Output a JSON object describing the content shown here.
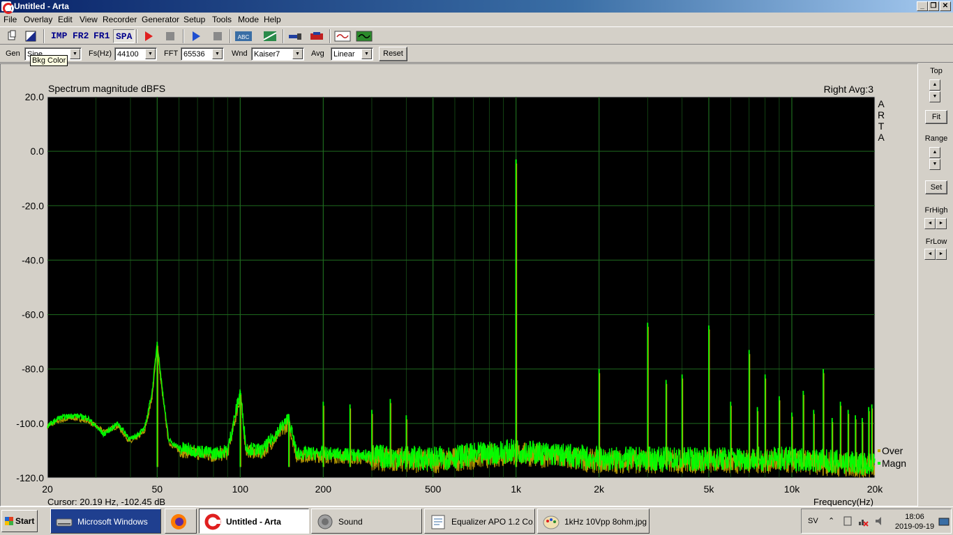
{
  "window": {
    "title": "Untitled - Arta",
    "min": "_",
    "restore": "❐",
    "close": "✕"
  },
  "menu": [
    "File",
    "Overlay",
    "Edit",
    "View",
    "Recorder",
    "Generator",
    "Setup",
    "Tools",
    "Mode",
    "Help"
  ],
  "toolbar": {
    "imp": "IMP",
    "fr2": "FR2",
    "fr1": "FR1",
    "spa": "SPA",
    "abc": "ABC"
  },
  "controls": {
    "gen_label": "Gen",
    "gen_value": "Sine",
    "fs_label": "Fs(Hz)",
    "fs_value": "44100",
    "fft_label": "FFT",
    "fft_value": "65536",
    "wnd_label": "Wnd",
    "wnd_value": "Kaiser7",
    "avg_label": "Avg",
    "avg_value": "Linear",
    "reset": "Reset",
    "tooltip": "Bkg Color"
  },
  "right_panel": {
    "top": "Top",
    "fit": "Fit",
    "range": "Range",
    "set": "Set",
    "frhigh": "FrHigh",
    "frlow": "FrLow"
  },
  "chart_data": {
    "type": "line",
    "title": "Spectrum magnitude dBFS",
    "channel_info": "Right  Avg:3",
    "watermark": "ARTA",
    "xlabel": "Frequency(Hz)",
    "ylabel": "",
    "x_scale": "log",
    "xlim": [
      20,
      20000
    ],
    "ylim": [
      -120,
      20
    ],
    "x_ticks": [
      20,
      50,
      100,
      200,
      500,
      1000,
      2000,
      5000,
      10000,
      20000
    ],
    "x_tick_labels": [
      "20",
      "50",
      "100",
      "200",
      "500",
      "1k",
      "2k",
      "5k",
      "10k",
      "20k"
    ],
    "y_ticks": [
      20,
      0,
      -20,
      -40,
      -60,
      -80,
      -100,
      -120
    ],
    "y_tick_labels": [
      "20.0",
      "0.0",
      "-20.0",
      "-40.0",
      "-60.0",
      "-80.0",
      "-100.0",
      "-120.0"
    ],
    "cursor": "Cursor: 20.19 Hz, -102.45 dB",
    "grid": true,
    "background": "#000000",
    "grid_color": "#1f6b1f",
    "legend_position": "bottom-right",
    "series": [
      {
        "name": "Over",
        "color": "#c8a800",
        "points": [
          [
            20,
            -101
          ],
          [
            22,
            -99
          ],
          [
            25,
            -98
          ],
          [
            28,
            -99
          ],
          [
            32,
            -103
          ],
          [
            36,
            -101
          ],
          [
            40,
            -107
          ],
          [
            45,
            -103
          ],
          [
            48,
            -90
          ],
          [
            50,
            -72
          ],
          [
            52,
            -88
          ],
          [
            55,
            -107
          ],
          [
            60,
            -110
          ],
          [
            70,
            -111
          ],
          [
            80,
            -112
          ],
          [
            90,
            -111
          ],
          [
            100,
            -90
          ],
          [
            105,
            -110
          ],
          [
            120,
            -111
          ],
          [
            150,
            -100
          ],
          [
            160,
            -112
          ],
          [
            200,
            -112
          ],
          [
            300,
            -113
          ],
          [
            500,
            -114
          ],
          [
            1000,
            -111
          ],
          [
            2000,
            -114
          ],
          [
            5000,
            -114
          ],
          [
            10000,
            -114
          ],
          [
            20000,
            -116
          ]
        ]
      },
      {
        "name": "Magn",
        "color": "#00ff00",
        "points": [
          [
            20,
            -101
          ],
          [
            22,
            -98
          ],
          [
            25,
            -97
          ],
          [
            28,
            -98
          ],
          [
            32,
            -104
          ],
          [
            36,
            -100
          ],
          [
            40,
            -106
          ],
          [
            45,
            -102
          ],
          [
            48,
            -88
          ],
          [
            50,
            -70
          ],
          [
            52,
            -86
          ],
          [
            55,
            -106
          ],
          [
            60,
            -109
          ],
          [
            70,
            -110
          ],
          [
            80,
            -111
          ],
          [
            90,
            -110
          ],
          [
            100,
            -88
          ],
          [
            105,
            -109
          ],
          [
            120,
            -110
          ],
          [
            150,
            -98
          ],
          [
            160,
            -111
          ],
          [
            200,
            -111
          ],
          [
            300,
            -112
          ],
          [
            500,
            -113
          ],
          [
            1000,
            -110
          ],
          [
            2000,
            -113
          ],
          [
            5000,
            -113
          ],
          [
            10000,
            -113
          ],
          [
            20000,
            -115
          ]
        ]
      }
    ],
    "peaks": [
      [
        50,
        -70
      ],
      [
        100,
        -88
      ],
      [
        150,
        -98
      ],
      [
        200,
        -92
      ],
      [
        250,
        -93
      ],
      [
        300,
        -95
      ],
      [
        350,
        -91
      ],
      [
        400,
        -97
      ],
      [
        1000,
        -3
      ],
      [
        2000,
        -80
      ],
      [
        3000,
        -63
      ],
      [
        3500,
        -84
      ],
      [
        4000,
        -82
      ],
      [
        5000,
        -64
      ],
      [
        6000,
        -92
      ],
      [
        7000,
        -73
      ],
      [
        7500,
        -94
      ],
      [
        8000,
        -82
      ],
      [
        9000,
        -90
      ],
      [
        10000,
        -96
      ],
      [
        11000,
        -88
      ],
      [
        12000,
        -95
      ],
      [
        13000,
        -80
      ],
      [
        14000,
        -98
      ],
      [
        15000,
        -92
      ],
      [
        16000,
        -95
      ],
      [
        17000,
        -97
      ],
      [
        18000,
        -98
      ],
      [
        19000,
        -94
      ],
      [
        19500,
        -93
      ]
    ]
  },
  "taskbar": {
    "start": "Start",
    "tasks": [
      "Microsoft Windows",
      "",
      "Untitled - Arta",
      "Sound",
      "Equalizer APO 1.2 Co...",
      "1kHz 10Vpp 8ohm.jpg..."
    ],
    "lang": "SV",
    "time": "18:06",
    "date": "2019-09-19"
  }
}
